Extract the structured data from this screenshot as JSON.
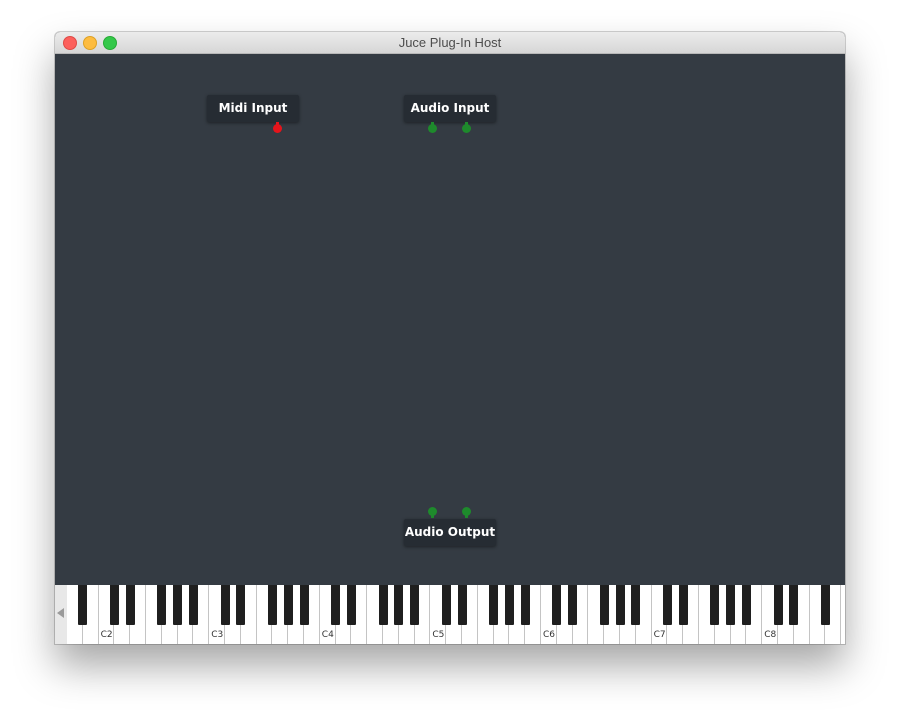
{
  "window": {
    "title": "Juce Plug-In Host"
  },
  "graph": {
    "nodes": {
      "midi_input": {
        "label": "Midi Input"
      },
      "audio_input": {
        "label": "Audio Input"
      },
      "audio_output": {
        "label": "Audio Output"
      }
    }
  },
  "keyboard": {
    "octave_labels": [
      "C2",
      "C3",
      "C4",
      "C5",
      "C6",
      "C7",
      "C8"
    ]
  },
  "colors": {
    "canvas": "#343b43",
    "node": "#262c33",
    "midi_pin": "#e5141b",
    "audio_pin": "#1e8a2c"
  }
}
